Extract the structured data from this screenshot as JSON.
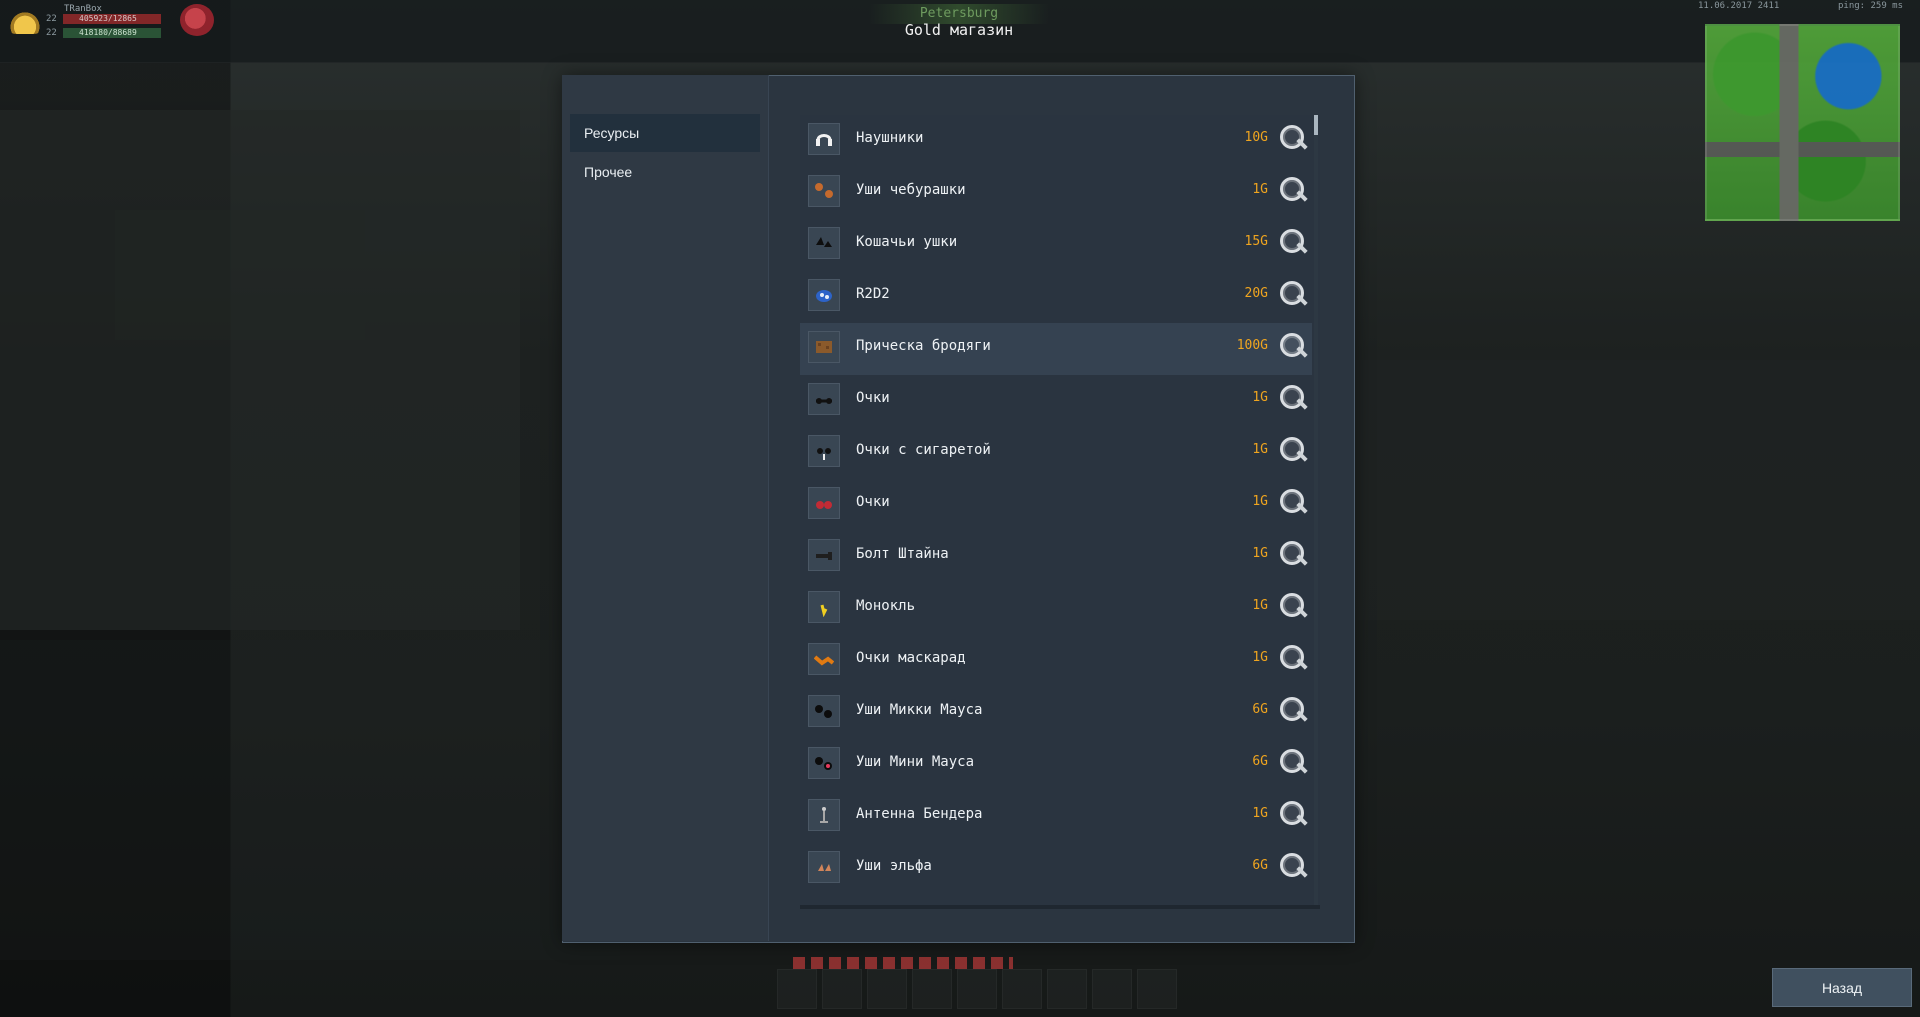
{
  "hud": {
    "player_name": "TRanBox",
    "level_hp": "22",
    "hp_text": "405923/12865",
    "level_xp": "22",
    "xp_text": "418180/88689",
    "city": "Petersburg",
    "shop_title": "Gold магазин",
    "clock": "11.06.2017 2411",
    "ping": "ping: 259 ms"
  },
  "sidebar": {
    "categories": [
      {
        "label": "Ресурсы",
        "active": true
      },
      {
        "label": "Прочее",
        "active": false
      }
    ]
  },
  "items": [
    {
      "name": "Наушники",
      "price": "10G",
      "icon": "headphones-icon",
      "color": "#f2f2f2"
    },
    {
      "name": "Уши чебурашки",
      "price": "1G",
      "icon": "cheburashka-ears-icon",
      "color": "#c56a2d"
    },
    {
      "name": "Кошачьи ушки",
      "price": "15G",
      "icon": "cat-ears-icon",
      "color": "#0e0e0e"
    },
    {
      "name": "R2D2",
      "price": "20G",
      "icon": "r2d2-icon",
      "color": "#2d63c8"
    },
    {
      "name": "Прическа бродяги",
      "price": "100G",
      "icon": "tramp-hair-icon",
      "color": "#8b5a2b"
    },
    {
      "name": "Очки",
      "price": "1G",
      "icon": "glasses-icon",
      "color": "#111111"
    },
    {
      "name": "Очки с сигаретой",
      "price": "1G",
      "icon": "glasses-cigarette-icon",
      "color": "#111111"
    },
    {
      "name": "Очки",
      "price": "1G",
      "icon": "red-glasses-icon",
      "color": "#c22b35"
    },
    {
      "name": "Болт Штайна",
      "price": "1G",
      "icon": "stein-bolt-icon",
      "color": "#1f1f1f"
    },
    {
      "name": "Монокль",
      "price": "1G",
      "icon": "monocle-icon",
      "color": "#f0cf21"
    },
    {
      "name": "Очки маскарад",
      "price": "1G",
      "icon": "masquerade-glasses-icon",
      "color": "#e07a12"
    },
    {
      "name": "Уши Микки Мауса",
      "price": "6G",
      "icon": "mickey-ears-icon",
      "color": "#0c0c0c"
    },
    {
      "name": "Уши Мини Мауса",
      "price": "6G",
      "icon": "minnie-ears-icon",
      "color": "#e63b5e"
    },
    {
      "name": "Антенна Бендера",
      "price": "1G",
      "icon": "bender-antenna-icon",
      "color": "#a7a7a7"
    },
    {
      "name": "Уши эльфа",
      "price": "6G",
      "icon": "elf-ears-icon",
      "color": "#d2855a"
    }
  ],
  "buttons": {
    "back": "Назад"
  },
  "colors": {
    "price": "#f0a51f",
    "modal": "#2b3540",
    "selected_row": "#354251"
  }
}
